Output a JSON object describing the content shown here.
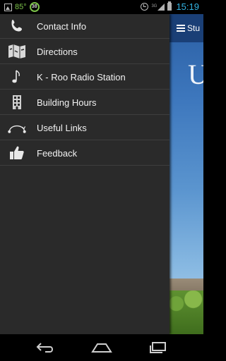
{
  "status_bar": {
    "temperature": "85°",
    "badge": "38",
    "network": "3G",
    "time": "15:19"
  },
  "app": {
    "actionbar_title": "Stu",
    "logo_letter": "U"
  },
  "drawer": {
    "items": [
      {
        "label": "Contact Info",
        "icon": "phone-icon"
      },
      {
        "label": "Directions",
        "icon": "map-icon"
      },
      {
        "label": "K - Roo Radio Station",
        "icon": "music-note-icon"
      },
      {
        "label": "Building Hours",
        "icon": "building-icon"
      },
      {
        "label": "Useful Links",
        "icon": "links-icon"
      },
      {
        "label": "Feedback",
        "icon": "thumbs-up-icon"
      }
    ]
  },
  "nav": {
    "back": "back-icon",
    "home": "home-icon",
    "recents": "recents-icon"
  },
  "colors": {
    "drawer_bg": "#2a2a2a",
    "actionbar": "#1a3f76",
    "time": "#33b5e5",
    "status_accent": "#7cc24a"
  }
}
